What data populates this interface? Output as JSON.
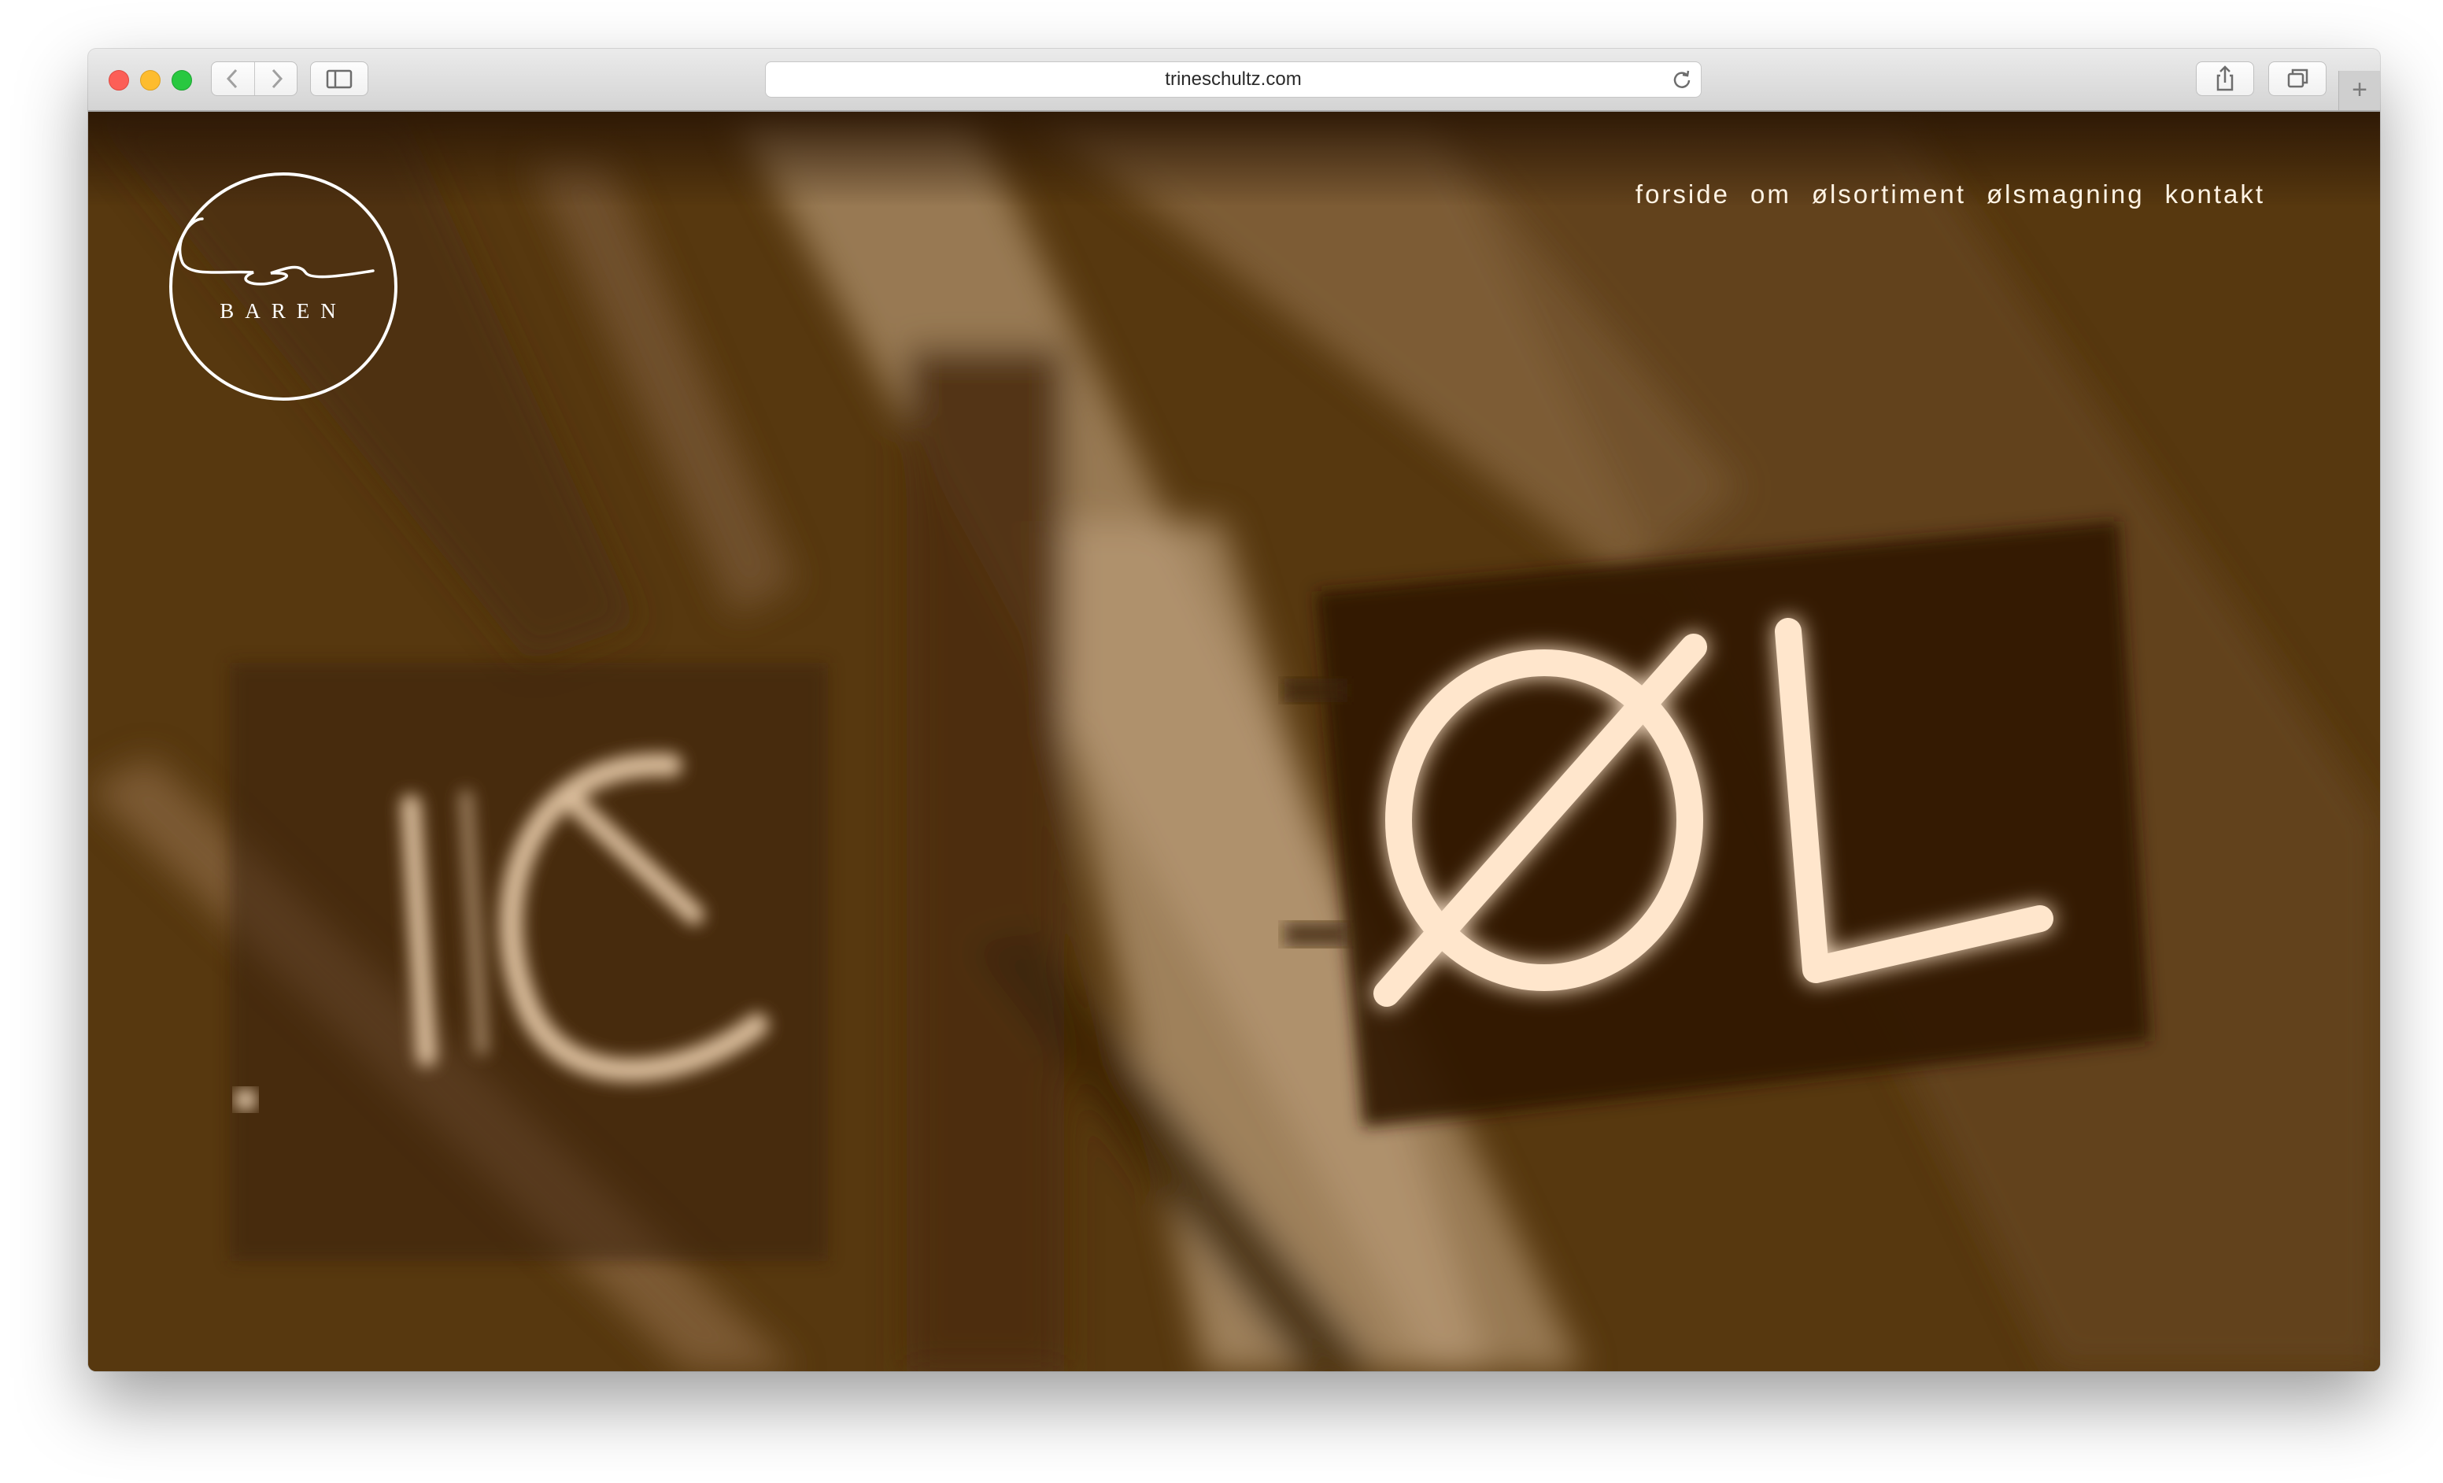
{
  "browser": {
    "url": "trineschultz.com"
  },
  "site": {
    "logo_text": "BAREN",
    "nav": [
      "forside",
      "om",
      "ølsortiment",
      "ølsmagning",
      "kontakt"
    ]
  },
  "hero": {
    "sign_text": "ØL",
    "reflection_text": "JC"
  },
  "colors": {
    "sepia_dark": "#4f3210",
    "sepia_mid": "#8a6a47",
    "neon": "#ffe6cc"
  }
}
